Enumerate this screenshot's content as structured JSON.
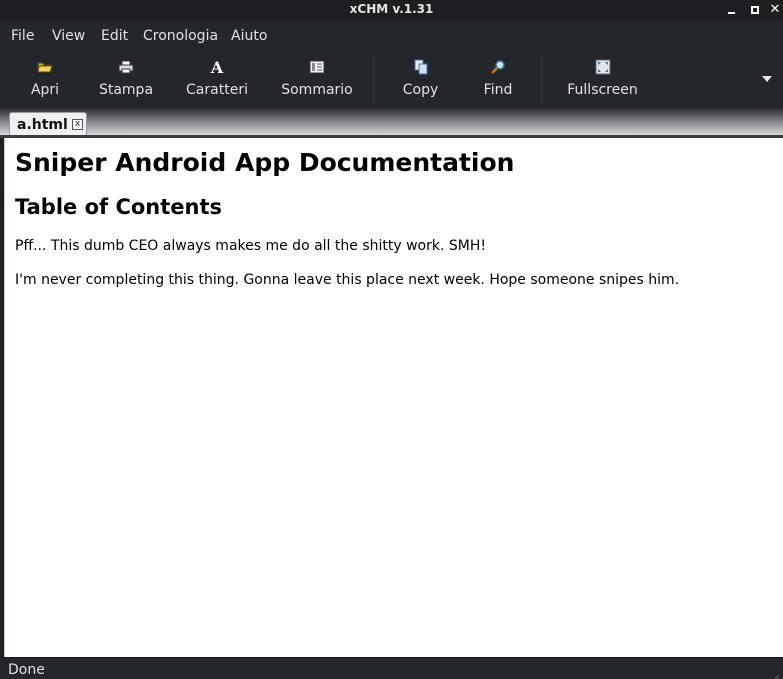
{
  "window": {
    "title": "xCHM v.1.31"
  },
  "menu": {
    "items": [
      {
        "label": "File"
      },
      {
        "label": "View"
      },
      {
        "label": "Edit"
      },
      {
        "label": "Cronologia"
      },
      {
        "label": "Aiuto"
      }
    ]
  },
  "toolbar": {
    "buttons": [
      {
        "label": "Apri",
        "icon": "open-folder-icon"
      },
      {
        "label": "Stampa",
        "icon": "printer-icon"
      },
      {
        "label": "Caratteri",
        "icon": "font-icon",
        "glyph": "A"
      },
      {
        "label": "Sommario",
        "icon": "contents-icon"
      },
      {
        "label": "Copy",
        "icon": "copy-icon"
      },
      {
        "label": "Find",
        "icon": "find-icon"
      },
      {
        "label": "Fullscreen",
        "icon": "fullscreen-icon"
      }
    ]
  },
  "tabs": [
    {
      "label": "a.html",
      "close_glyph": "x"
    }
  ],
  "document": {
    "h1": "Sniper Android App Documentation",
    "h2": "Table of Contents",
    "paragraphs": [
      "Pff... This dumb CEO always makes me do all the shitty work. SMH!",
      "I'm never completing this thing. Gonna leave this place next week. Hope someone snipes him."
    ]
  },
  "status": {
    "text": "Done"
  },
  "colors": {
    "chrome_bg": "#23262b",
    "titlebar_bg": "#1c1e22",
    "text_light": "#e2e2e2",
    "content_bg": "#ffffff"
  }
}
